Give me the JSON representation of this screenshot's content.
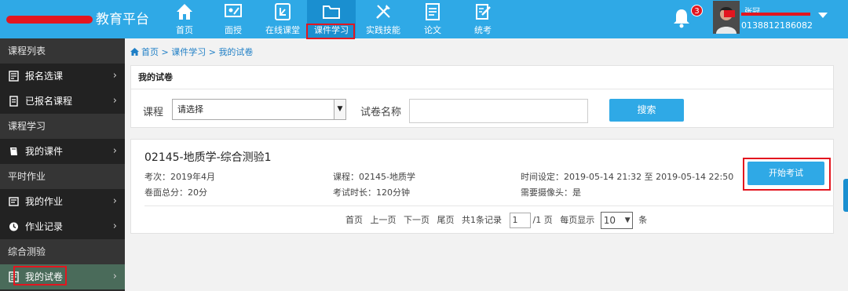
{
  "header": {
    "brand": "教育平台",
    "nav": [
      {
        "label": "首页",
        "icon": "home-icon"
      },
      {
        "label": "面授",
        "icon": "whiteboard-icon"
      },
      {
        "label": "在线课堂",
        "icon": "online-class-icon"
      },
      {
        "label": "课件学习",
        "icon": "folder-icon",
        "active": true
      },
      {
        "label": "实践技能",
        "icon": "tools-icon"
      },
      {
        "label": "论文",
        "icon": "document-icon"
      },
      {
        "label": "统考",
        "icon": "edit-icon"
      }
    ],
    "notifications": "3",
    "user_name": "张冠",
    "user_id": "0138812186082",
    "accent": "#2fa9e6",
    "highlight": "#e3161f"
  },
  "sidebar": {
    "groups": [
      {
        "title": "课程列表",
        "items": [
          {
            "label": "报名选课",
            "icon": "enroll-icon"
          },
          {
            "label": "已报名课程",
            "icon": "registered-course-icon"
          }
        ]
      },
      {
        "title": "课程学习",
        "items": [
          {
            "label": "我的课件",
            "icon": "book-icon"
          }
        ]
      },
      {
        "title": "平时作业",
        "items": [
          {
            "label": "我的作业",
            "icon": "homework-icon"
          },
          {
            "label": "作业记录",
            "icon": "clock-icon"
          }
        ]
      },
      {
        "title": "综合测验",
        "items": [
          {
            "label": "我的试卷",
            "icon": "exam-paper-icon",
            "active": true
          }
        ]
      }
    ]
  },
  "breadcrumb": {
    "home": "首页",
    "sep": ">",
    "section": "课件学习",
    "current": "我的试卷"
  },
  "panel": {
    "title": "我的试卷",
    "course_label": "课程",
    "course_value": "请选择",
    "name_label": "试卷名称",
    "name_placeholder": "",
    "search_button": "搜索"
  },
  "exam": {
    "title": "02145-地质学-综合测验1",
    "session": "考次：2019年4月",
    "total_score": "卷面总分：20分",
    "course": "课程：02145-地质学",
    "duration": "考试时长：120分钟",
    "time_setting": "时间设定：2019-05-14 21:32  至  2019-05-14 22:50",
    "camera": "需要摄像头：是",
    "start_button": "开始考试"
  },
  "pager": {
    "first": "首页",
    "prev": "上一页",
    "next": "下一页",
    "last": "尾页",
    "records": "共1条记录",
    "page": "1",
    "total_pages": "/1 页",
    "per_page_label": "每页显示",
    "per_page": "10",
    "unit": "条"
  }
}
